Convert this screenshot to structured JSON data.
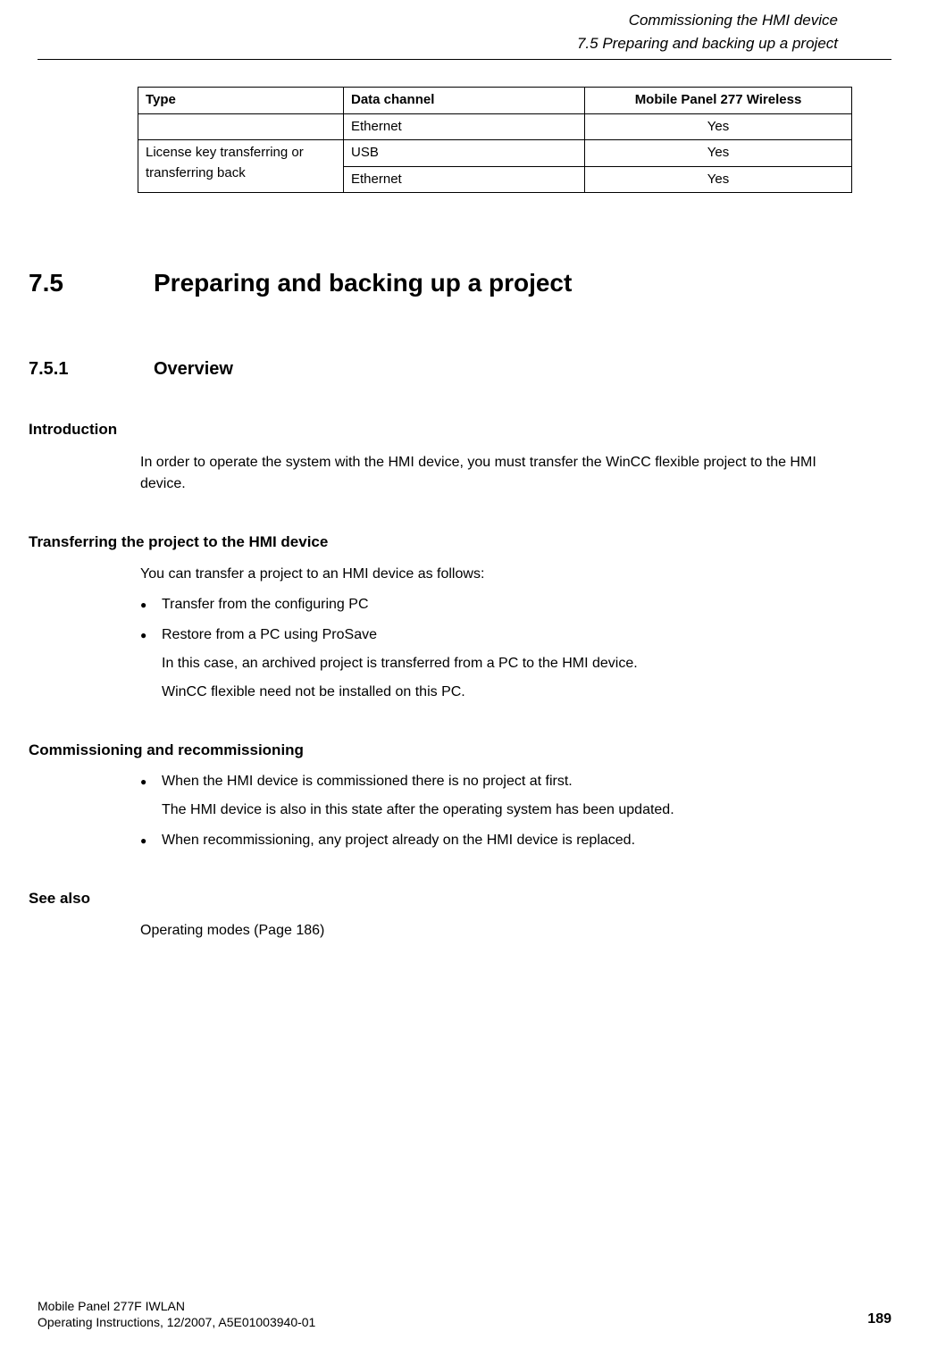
{
  "header": {
    "chapter": "Commissioning the HMI device",
    "section": "7.5 Preparing and backing up a project"
  },
  "table": {
    "headers": {
      "type": "Type",
      "channel": "Data channel",
      "device": "Mobile Panel 277 Wireless"
    },
    "rows": {
      "r1": {
        "type": "",
        "channel": "Ethernet",
        "value": "Yes"
      },
      "r2": {
        "type": "License key transferring or transferring back",
        "channel": "USB",
        "value": "Yes"
      },
      "r3": {
        "channel": "Ethernet",
        "value": "Yes"
      }
    }
  },
  "sec": {
    "num": "7.5",
    "title": "Preparing and backing up a project"
  },
  "subsec": {
    "num": "7.5.1",
    "title": "Overview"
  },
  "intro": {
    "heading": "Introduction",
    "text": "In order to operate the system with the HMI device, you must transfer the WinCC flexible project to the HMI device."
  },
  "transfer": {
    "heading": "Transferring the project to the HMI device",
    "lead": "You can transfer a project to an HMI device as follows:",
    "b1": "Transfer from the configuring PC",
    "b2": "Restore from a PC using ProSave",
    "b2a": "In this case, an archived project is transferred from a PC to the HMI device.",
    "b2b": "WinCC flexible need not be installed on this PC."
  },
  "commissioning": {
    "heading": "Commissioning and recommissioning",
    "b1": "When the HMI device is commissioned there is no project at first.",
    "b1a": "The HMI device is also in this state after the operating system has been updated.",
    "b2": "When recommissioning, any project already on the HMI device is replaced."
  },
  "seealso": {
    "heading": "See also",
    "text": "Operating modes (Page 186)"
  },
  "footer": {
    "line1": "Mobile Panel 277F IWLAN",
    "line2": "Operating Instructions, 12/2007, A5E01003940-01",
    "page": "189"
  }
}
